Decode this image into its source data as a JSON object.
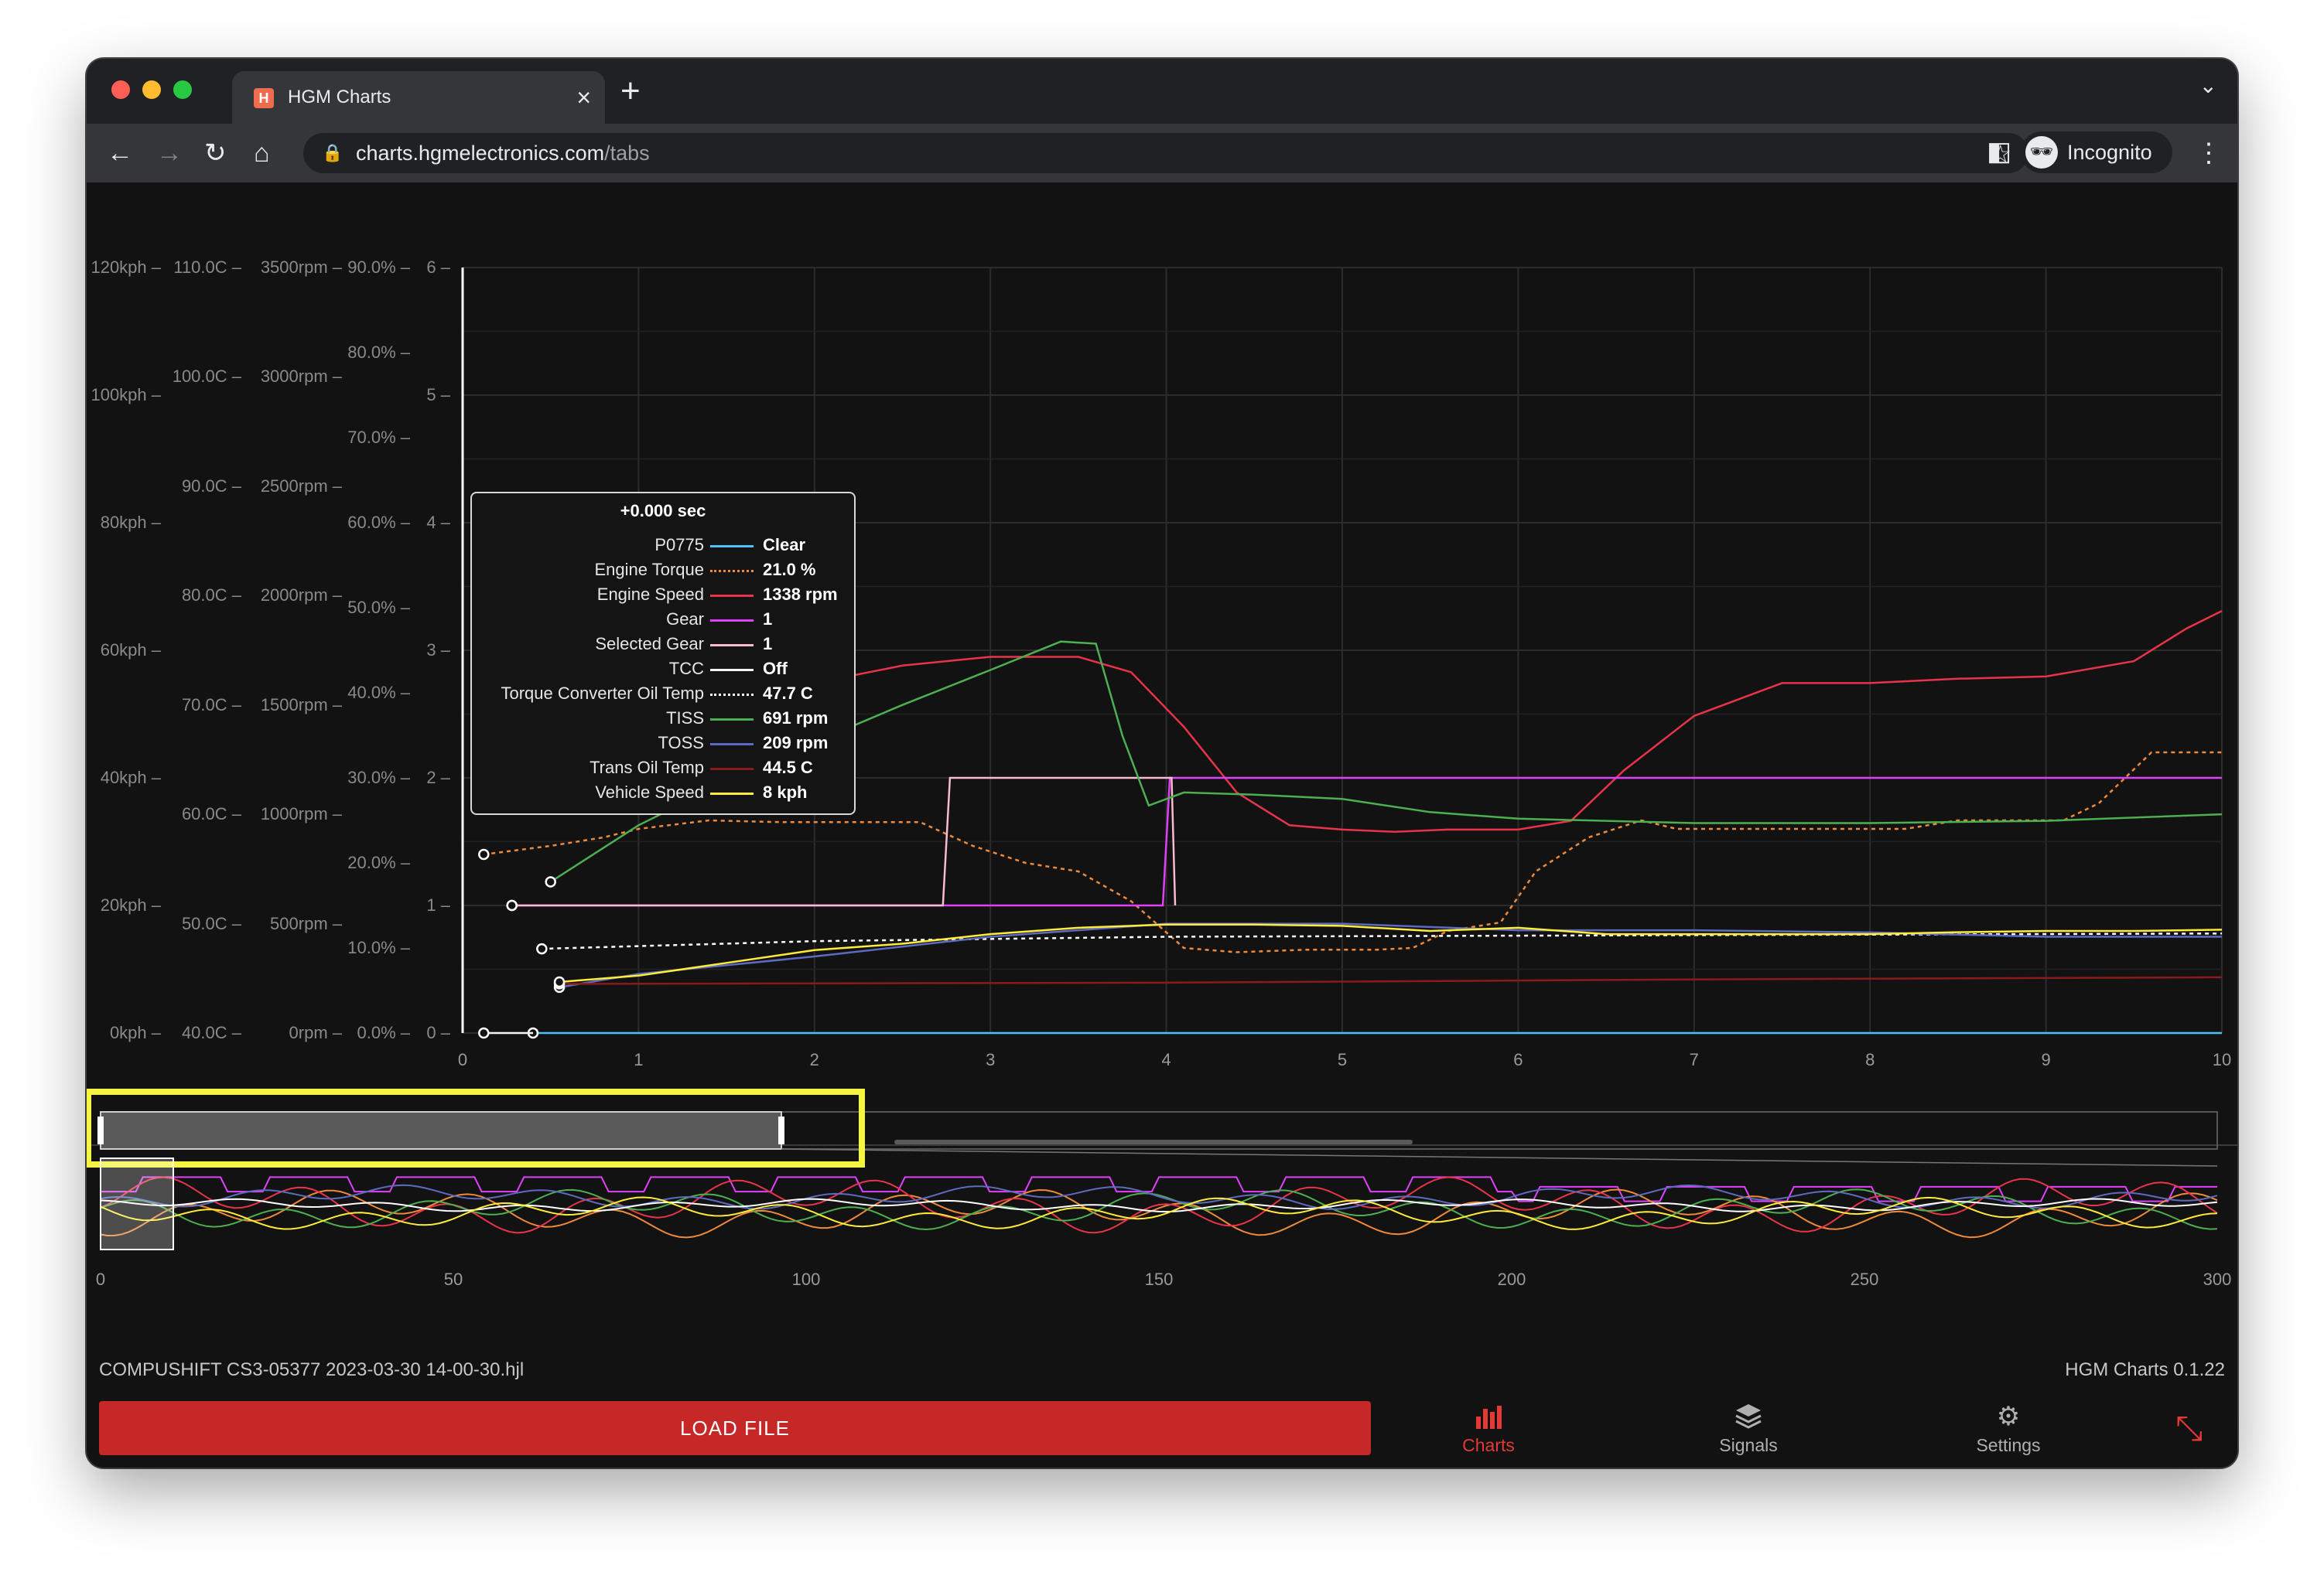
{
  "browser": {
    "tab_title": "HGM Charts",
    "url_domain": "charts.hgmelectronics.com",
    "url_path": "/tabs",
    "profile_label": "Incognito"
  },
  "chart_data": {
    "type": "line",
    "axes": {
      "vehicle_speed": {
        "ticks": [
          "0kph",
          "20kph",
          "40kph",
          "60kph",
          "80kph",
          "100kph",
          "120kph"
        ],
        "ylim": [
          0,
          120
        ]
      },
      "temperature": {
        "ticks": [
          "40.0C",
          "50.0C",
          "60.0C",
          "70.0C",
          "80.0C",
          "90.0C",
          "100.0C",
          "110.0C"
        ],
        "ylim": [
          40,
          110
        ]
      },
      "speed_rpm": {
        "ticks": [
          "0rpm",
          "500rpm",
          "1000rpm",
          "1500rpm",
          "2000rpm",
          "2500rpm",
          "3000rpm",
          "3500rpm"
        ],
        "ylim": [
          0,
          3500
        ]
      },
      "percent": {
        "ticks": [
          "0.0%",
          "10.0%",
          "20.0%",
          "30.0%",
          "40.0%",
          "50.0%",
          "60.0%",
          "70.0%",
          "80.0%",
          "90.0%"
        ],
        "ylim": [
          0,
          90
        ]
      },
      "gear": {
        "ticks": [
          "0",
          "1",
          "2",
          "3",
          "4",
          "5",
          "6"
        ],
        "ylim": [
          0,
          6
        ]
      },
      "x": {
        "ticks": [
          "0",
          "1",
          "2",
          "3",
          "4",
          "5",
          "6",
          "7",
          "8",
          "9",
          "10"
        ],
        "xlim": [
          0,
          10
        ]
      }
    },
    "grid": true,
    "series": [
      {
        "name": "P0775",
        "color": "#4fc3f7",
        "style": "solid",
        "axis": "gear",
        "x": [
          0.4,
          10
        ],
        "y": [
          0,
          0
        ]
      },
      {
        "name": "Engine Torque",
        "color": "#ef8a3a",
        "style": "dotted",
        "axis": "percent",
        "x": [
          0.12,
          0.5,
          0.8,
          1.0,
          1.4,
          1.8,
          2.2,
          2.6,
          2.9,
          3.2,
          3.5,
          3.8,
          4.1,
          4.4,
          4.8,
          5.2,
          5.4,
          5.6,
          5.9,
          6.1,
          6.4,
          6.7,
          6.9,
          7.2,
          7.5,
          7.8,
          8.2,
          8.5,
          8.8,
          9.1,
          9.3,
          9.6,
          10
        ],
        "y": [
          21,
          22,
          23,
          24,
          25,
          24.8,
          24.8,
          24.8,
          22,
          20,
          19,
          15.5,
          10,
          9.5,
          9.8,
          9.8,
          10,
          12,
          13,
          19,
          23,
          25,
          24,
          24,
          24,
          24,
          24,
          25,
          25,
          25,
          27,
          33,
          33
        ]
      },
      {
        "name": "Engine Speed",
        "color": "#e8344a",
        "style": "solid",
        "axis": "speed_rpm",
        "x": [
          0.5,
          1,
          1.5,
          2,
          2.5,
          3,
          3.5,
          3.8,
          4.1,
          4.4,
          4.7,
          5,
          5.3,
          5.6,
          6,
          6.3,
          6.6,
          7,
          7.5,
          8,
          8.5,
          9,
          9.5,
          9.8,
          10
        ],
        "y": [
          1300,
          1400,
          1500,
          1600,
          1680,
          1720,
          1720,
          1650,
          1400,
          1100,
          950,
          930,
          920,
          930,
          930,
          970,
          1200,
          1450,
          1600,
          1600,
          1620,
          1630,
          1700,
          1850,
          1930
        ]
      },
      {
        "name": "Gear",
        "color": "#e040fb",
        "style": "solid",
        "axis": "gear",
        "x": [
          0.28,
          3.98,
          4.02,
          10
        ],
        "y": [
          1,
          1,
          2,
          2
        ]
      },
      {
        "name": "Selected Gear",
        "color": "#f8bbd0",
        "style": "solid",
        "axis": "gear",
        "x": [
          0.28,
          2.73,
          2.77,
          4.03,
          4.05
        ],
        "y": [
          1,
          1,
          2,
          2,
          1
        ]
      },
      {
        "name": "TCC",
        "color": "#f5f5f5",
        "style": "solid",
        "axis": "gear",
        "x": [
          0.12,
          0.4
        ],
        "y": [
          0,
          0
        ]
      },
      {
        "name": "Torque Converter Oil Temp",
        "color": "#ffffff",
        "style": "dotted",
        "axis": "temperature",
        "x": [
          0.45,
          2,
          4,
          6,
          8,
          10
        ],
        "y": [
          47.7,
          48.4,
          48.8,
          48.9,
          49.0,
          49.1
        ]
      },
      {
        "name": "TISS",
        "color": "#4caf50",
        "style": "solid",
        "axis": "speed_rpm",
        "x": [
          0.5,
          1,
          1.5,
          2,
          2.5,
          3,
          3.4,
          3.6,
          3.75,
          3.9,
          4.1,
          4.5,
          5,
          5.5,
          6,
          7,
          8,
          9,
          10
        ],
        "y": [
          691,
          950,
          1150,
          1330,
          1500,
          1660,
          1790,
          1780,
          1360,
          1040,
          1100,
          1090,
          1070,
          1010,
          980,
          960,
          960,
          970,
          1000
        ]
      },
      {
        "name": "TOSS",
        "color": "#5c6bc0",
        "style": "solid",
        "axis": "speed_rpm",
        "x": [
          0.55,
          1,
          2,
          3,
          4,
          5,
          6,
          7,
          8,
          9,
          10
        ],
        "y": [
          209,
          270,
          350,
          440,
          500,
          500,
          470,
          470,
          460,
          440,
          440
        ]
      },
      {
        "name": "Trans Oil Temp",
        "color": "#8b1a1a",
        "style": "solid",
        "axis": "temperature",
        "x": [
          0.55,
          4,
          7,
          10
        ],
        "y": [
          44.5,
          44.6,
          44.9,
          45.1
        ]
      },
      {
        "name": "Vehicle Speed",
        "color": "#ffeb3b",
        "style": "solid",
        "axis": "vehicle_speed",
        "x": [
          0.55,
          1,
          1.5,
          2,
          2.5,
          3,
          3.5,
          4,
          4.5,
          5,
          5.5,
          6,
          6.5,
          7,
          7.5,
          8,
          8.5,
          9,
          9.5,
          10
        ],
        "y": [
          8,
          9,
          11,
          13,
          14,
          15.5,
          16.5,
          17,
          17,
          16.8,
          16,
          16.5,
          15.5,
          15.5,
          15.5,
          15.5,
          15.8,
          16,
          16,
          16.2
        ]
      }
    ]
  },
  "tooltip": {
    "title": "+0.000 sec",
    "rows": [
      {
        "name": "P0775",
        "value": "Clear",
        "color": "#4fc3f7",
        "style": "solid"
      },
      {
        "name": "Engine Torque",
        "value": "21.0 %",
        "color": "#ef8a3a",
        "style": "dotted"
      },
      {
        "name": "Engine Speed",
        "value": "1338 rpm",
        "color": "#e8344a",
        "style": "solid"
      },
      {
        "name": "Gear",
        "value": "1",
        "color": "#e040fb",
        "style": "solid"
      },
      {
        "name": "Selected Gear",
        "value": "1",
        "color": "#f8bbd0",
        "style": "solid"
      },
      {
        "name": "TCC",
        "value": "Off",
        "color": "#f5f5f5",
        "style": "solid"
      },
      {
        "name": "Torque Converter Oil Temp",
        "value": "47.7 C",
        "color": "#ffffff",
        "style": "dotted"
      },
      {
        "name": "TISS",
        "value": "691 rpm",
        "color": "#4caf50",
        "style": "solid"
      },
      {
        "name": "TOSS",
        "value": "209 rpm",
        "color": "#5c6bc0",
        "style": "solid"
      },
      {
        "name": "Trans Oil Temp",
        "value": "44.5 C",
        "color": "#8b1a1a",
        "style": "solid"
      },
      {
        "name": "Vehicle Speed",
        "value": "8 kph",
        "color": "#ffeb3b",
        "style": "solid"
      }
    ]
  },
  "overview": {
    "x_ticks": [
      "0",
      "50",
      "100",
      "150",
      "200",
      "250",
      "300"
    ],
    "xlim": [
      0,
      300
    ],
    "selected_range": [
      0,
      10
    ],
    "highlight_color": "#f5f542"
  },
  "footer": {
    "filename": "COMPUSHIFT CS3-05377 2023-03-30 14-00-30.hjl",
    "version": "HGM Charts 0.1.22",
    "load_button": "LOAD FILE"
  },
  "nav": {
    "charts": "Charts",
    "signals": "Signals",
    "settings": "Settings"
  },
  "colors": {
    "accent": "#c62828",
    "active_nav": "#e53935",
    "inactive_nav": "#b0b0b0"
  }
}
